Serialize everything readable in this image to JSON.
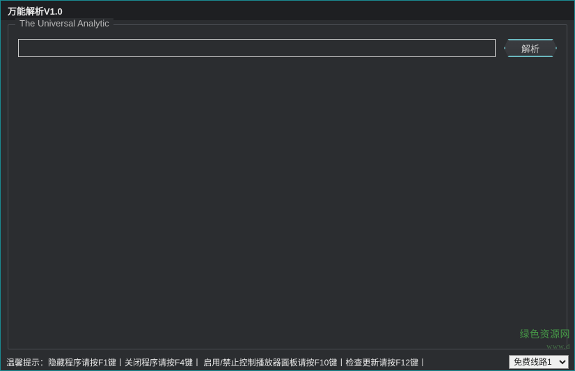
{
  "titlebar": {
    "title": "万能解析V1.0"
  },
  "groupbox": {
    "title": "The Universal Analytic"
  },
  "input": {
    "value": "",
    "placeholder": ""
  },
  "buttons": {
    "parse_label": "解析"
  },
  "statusbar": {
    "hint": "温馨提示：隐藏程序请按F1键丨关闭程序请按F4键丨 启用/禁止控制播放器面板请按F10键丨检查更新请按F12键丨"
  },
  "line_select": {
    "selected": "免费线路1",
    "options": [
      "免费线路1"
    ]
  },
  "watermark": {
    "line1": "绿色资源网",
    "line2": "www.d"
  }
}
